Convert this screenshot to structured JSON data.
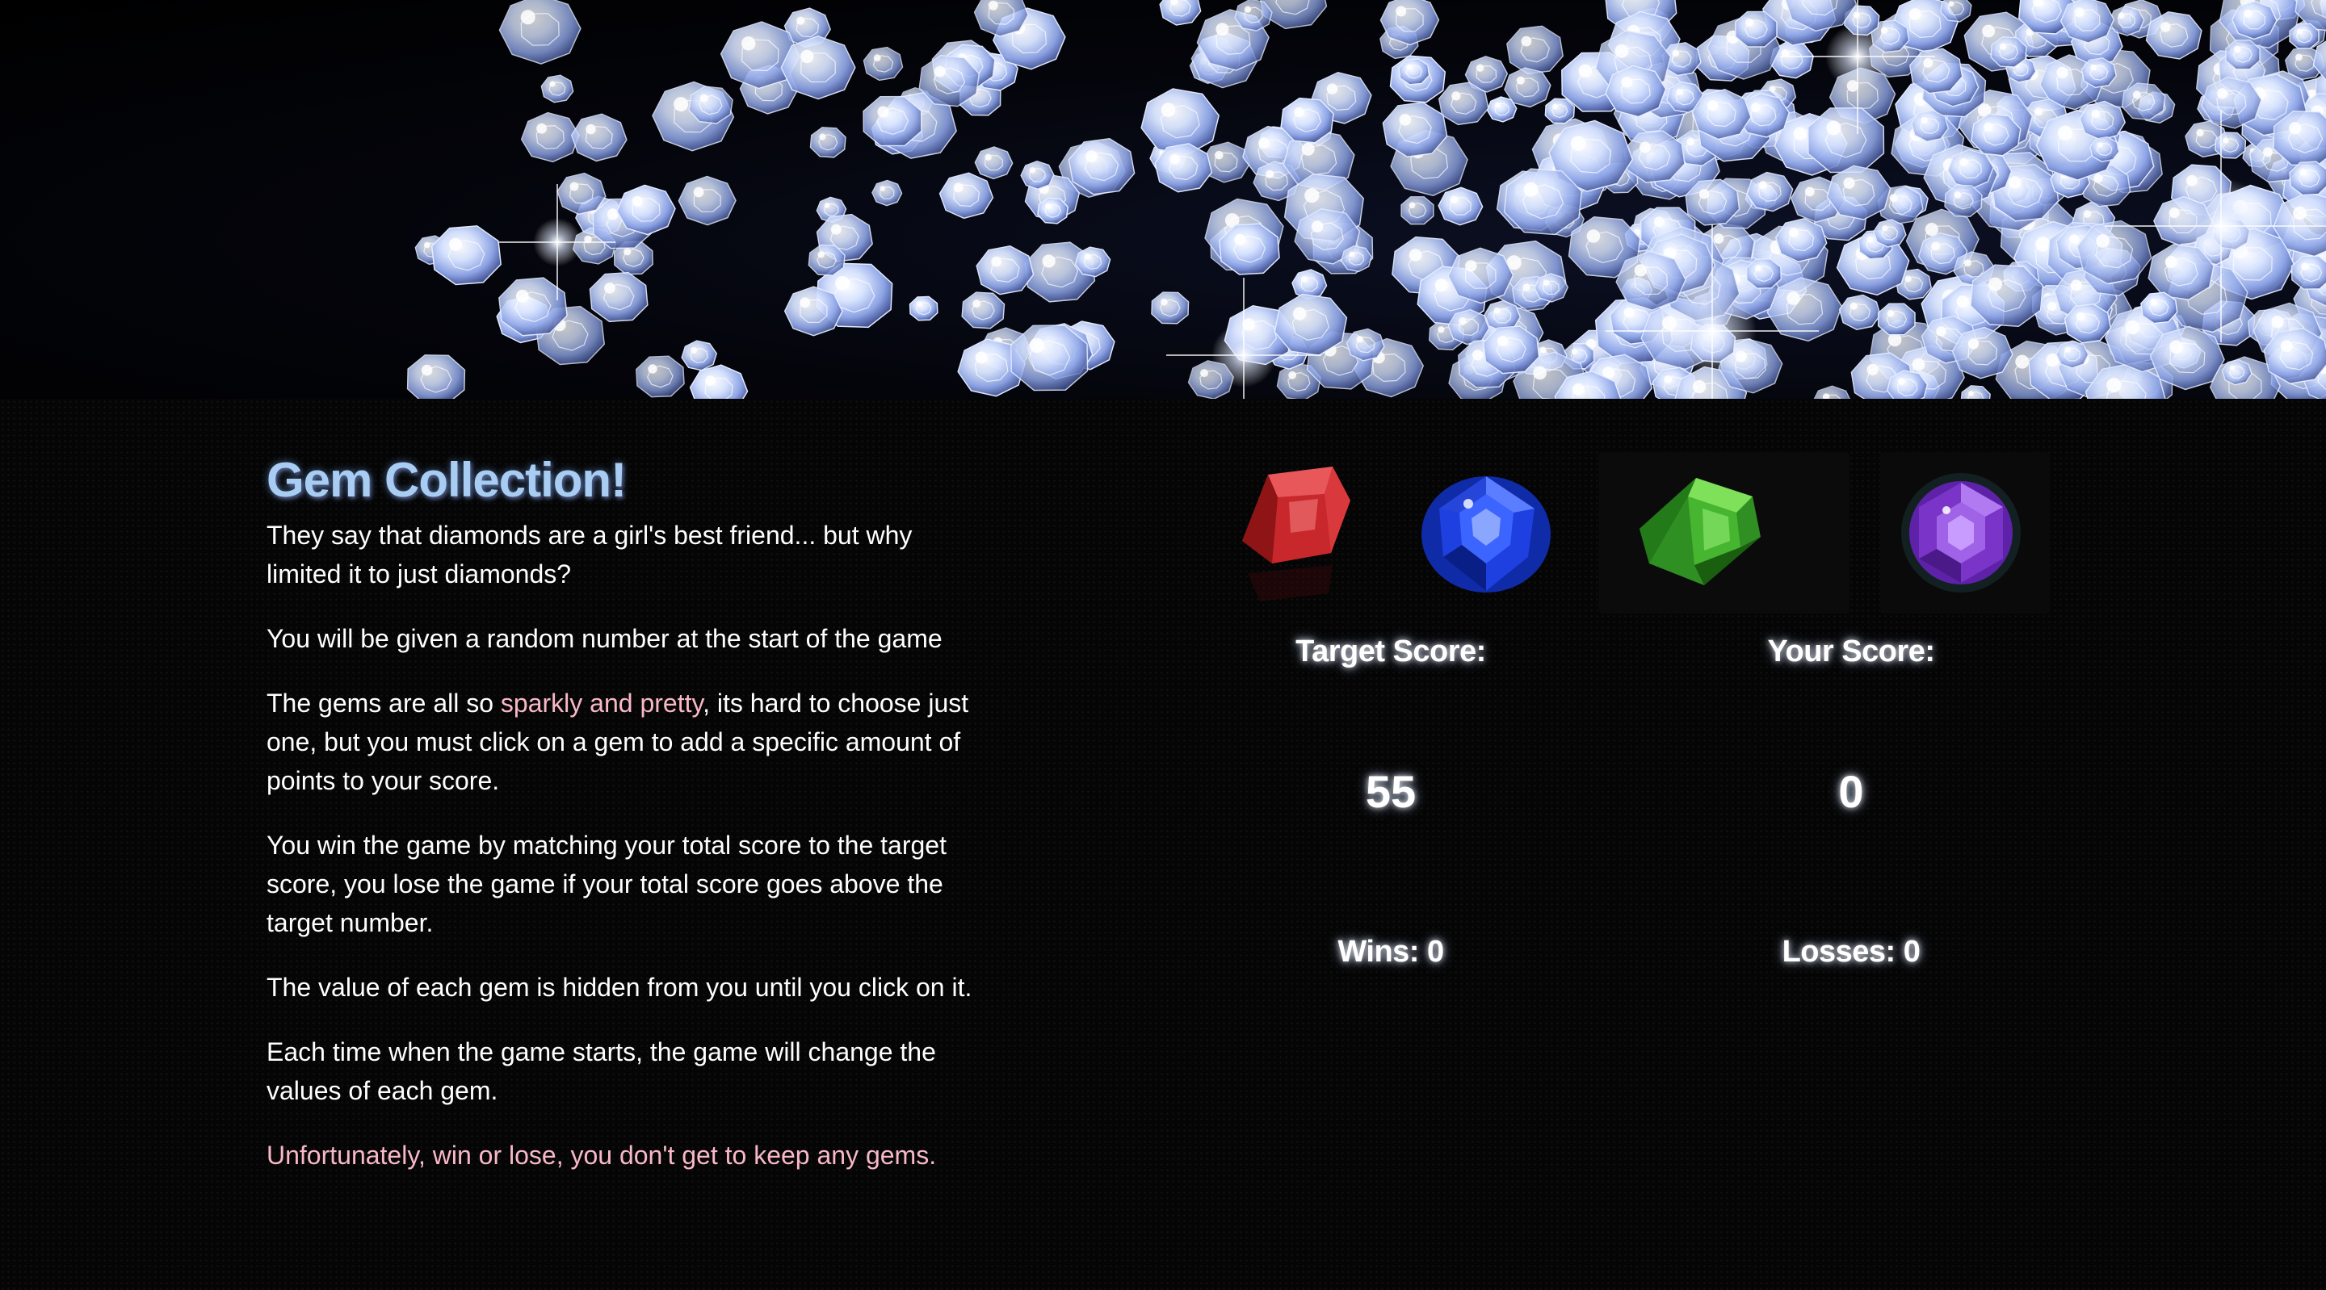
{
  "intro": {
    "title": "Gem Collection!",
    "p1": "They say that diamonds are a girl's best friend... but why limited it to just diamonds?",
    "p2": "You will be given a random number at the start of the game",
    "p3_before": "The gems are all so ",
    "p3_highlight": "sparkly and pretty",
    "p3_after": ", its hard to choose just one, but you must click on a gem to add a specific amount of points to your score.",
    "p4": "You win the game by matching your total score to the target score, you lose the game if your total score goes above the target number.",
    "p5": "The value of each gem is hidden from you until you click on it.",
    "p6": "Each time when the game starts, the game will change the values of each gem.",
    "p7": "Unfortunately, win or lose, you don't get to keep any gems."
  },
  "gems": [
    {
      "name": "ruby",
      "icon": "ruby-gem-icon",
      "color": "#c42a2a"
    },
    {
      "name": "sapphire",
      "icon": "sapphire-gem-icon",
      "color": "#1f3fd6"
    },
    {
      "name": "emerald",
      "icon": "emerald-gem-icon",
      "color": "#35a62a"
    },
    {
      "name": "amethyst",
      "icon": "amethyst-gem-icon",
      "color": "#8a3fd0"
    }
  ],
  "scoreboard": {
    "target_label": "Target Score:",
    "target_value": "55",
    "your_label": "Your Score:",
    "your_value": "0",
    "wins": "Wins: 0",
    "losses": "Losses: 0"
  },
  "colors": {
    "title": "#a9cdf2",
    "highlight": "#f9b8c8",
    "text": "#ffffff",
    "background": "#050505"
  }
}
